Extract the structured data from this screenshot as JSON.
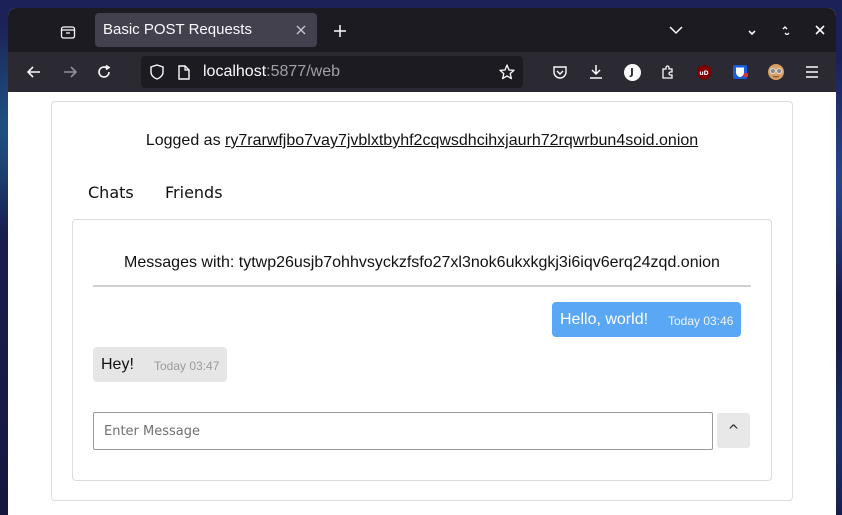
{
  "browser": {
    "tab_title": "Basic POST Requests",
    "url_host": "localhost",
    "url_rest": ":5877/web",
    "profile_initial": "J",
    "ublock_label": "uD"
  },
  "page": {
    "logged_prefix": "Logged as",
    "logged_user": "ry7rarwfjbo7vay7jvblxtbyhf2cqwsdhcihxjaurh72rqwrbun4soid.onion",
    "tabs": {
      "chats": "Chats",
      "friends": "Friends"
    },
    "messages_header": "Messages with: tytwp26usjb7ohhvsyckzfsfo27xl3nok6ukxkgkj3i6iqv6erq24zqd.onion",
    "messages": [
      {
        "text": "Hello, world!",
        "time": "Today 03:46",
        "direction": "outgoing"
      },
      {
        "text": "Hey!",
        "time": "Today 03:47",
        "direction": "incoming"
      }
    ],
    "input_placeholder": "Enter Message",
    "send_label": "^"
  },
  "colors": {
    "accent_bubble": "#5aa8f5",
    "incoming_bubble": "#e6e6e6",
    "chrome_dark": "#1c1b22"
  }
}
